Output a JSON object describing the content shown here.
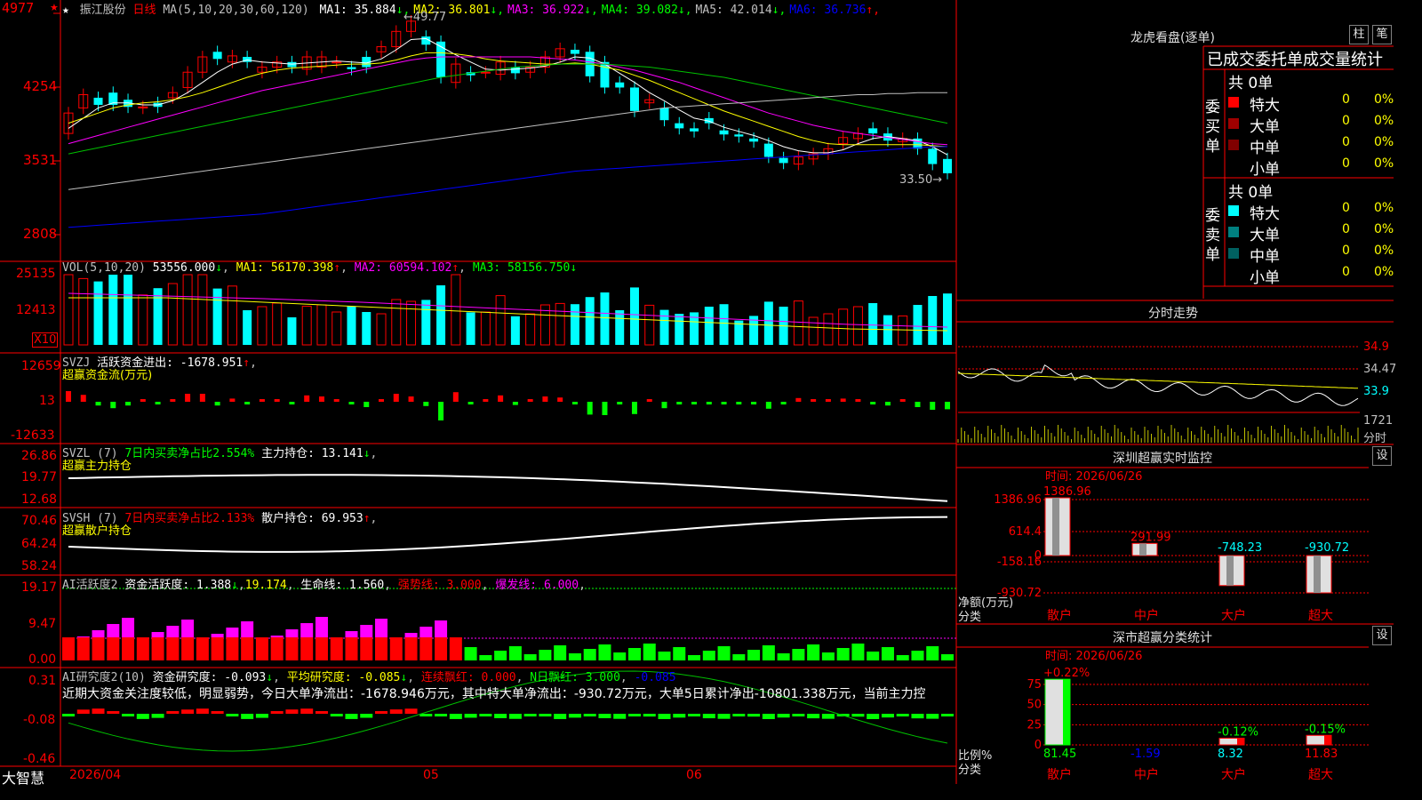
{
  "app": {
    "brand": "大智慧",
    "menu_star": "★",
    "menu_star_small": "★"
  },
  "header": {
    "stock_name": "振江股份",
    "period": "日线",
    "ma_text": "MA(5,10,20,30,60,120)",
    "ma_values": [
      {
        "label": "MA1: 35.884",
        "arrow": "↓",
        "color": "#ffffff"
      },
      {
        "label": "MA2: 36.801",
        "arrow": "↓",
        "color": "#ffff00"
      },
      {
        "label": "MA3: 36.922",
        "arrow": "↓",
        "color": "#ff00ff"
      },
      {
        "label": "MA4: 39.082",
        "arrow": "↓",
        "color": "#00ff00"
      },
      {
        "label": "MA5: 42.014",
        "arrow": "↓",
        "color": "#c0c0c0"
      },
      {
        "label": "MA6: 36.736",
        "arrow": "↑",
        "color": "#0000ff"
      }
    ]
  },
  "colors": {
    "up": "#ff0000",
    "down": "#00ffff",
    "grid": "#ff0000",
    "ma1": "#ffffff",
    "ma2": "#ffff00",
    "ma3": "#ff00ff",
    "ma4": "#00c000",
    "ma5": "#c0c0c0",
    "ma6": "#0000ff"
  },
  "price_panel": {
    "y_ticks": [
      "4977",
      "4254",
      "3531",
      "2808"
    ],
    "high_label": "49.77",
    "low_label": "33.50"
  },
  "vol_panel": {
    "title": "VOL(5,10,20)",
    "value": "53556.000",
    "ma1": "MA1: 56170.398",
    "ma1_arrow": "↑",
    "ma2": "MA2: 60594.102",
    "ma2_arrow": "↑",
    "ma3": "MA3: 58156.750",
    "ma3_arrow": "↓",
    "y_ticks": [
      "25135",
      "12413"
    ],
    "unit": "X10"
  },
  "svzj_panel": {
    "title": "SVZJ",
    "desc": "活跃资金进出: -1678.951",
    "arrow": "↑",
    "subtitle": "超赢资金流(万元)",
    "y_ticks": [
      "12659",
      "13",
      "-12633"
    ]
  },
  "svzl_panel": {
    "title": "SVZL (7)",
    "desc": "7日内买卖净占比2.554%",
    "desc2": "主力持仓: 13.141",
    "arrow": "↓",
    "subtitle": "超赢主力持仓",
    "y_ticks": [
      "26.86",
      "19.77",
      "12.68"
    ]
  },
  "svsh_panel": {
    "title": "SVSH (7)",
    "desc": "7日内买卖净占比2.133%",
    "desc2": "散户持仓: 69.953",
    "arrow": "↑",
    "subtitle": "超赢散户持仓",
    "y_ticks": [
      "70.46",
      "64.24",
      "58.24"
    ]
  },
  "ai_act_panel": {
    "title": "AI活跃度2",
    "desc": "资金活跃度: 1.388",
    "arrow": "↓",
    "val2": "19.174",
    "life": "生命线: 1.560",
    "strong": "强势线: 3.000",
    "burst": "爆发线: 6.000",
    "y_ticks": [
      "19.17",
      "9.47",
      "0.00"
    ]
  },
  "ai_res_panel": {
    "title": "AI研究度2(10)",
    "desc": "资金研究度: -0.093",
    "arrow1": "↓",
    "avg": "平均研究度: -0.085",
    "arrow2": "↓",
    "streak": "连续飘红: 0.000",
    "nday": "N日飘红: 3.000",
    "last": "-0.085",
    "comment": "近期大资金关注度较低，明显弱势，今日大单净流出：-1678.946万元，其中特大单净流出：-930.72万元，大单5日累计净出-10801.338万元，当前主力控",
    "y_ticks": [
      "0.31",
      "-0.08",
      "-0.46"
    ]
  },
  "x_axis": {
    "labels": [
      "2026/04",
      "05",
      "06"
    ]
  },
  "right": {
    "lhb_title": "龙虎看盘(逐单)",
    "btn_zhu": "柱",
    "btn_bi": "笔",
    "lhb_header": "已成交委托单成交量统计",
    "buy_label": "委买单",
    "sell_label": "委卖单",
    "buy_total": "共 0单",
    "sell_total": "共 0单",
    "buy_rows": [
      {
        "name": "特大",
        "count": "0",
        "pct": "0%",
        "color": "#ff0000"
      },
      {
        "name": "大单",
        "count": "0",
        "pct": "0%",
        "color": "#a00000"
      },
      {
        "name": "中单",
        "count": "0",
        "pct": "0%",
        "color": "#800000"
      },
      {
        "name": "小单",
        "count": "0",
        "pct": "0%",
        "color": "#000000"
      }
    ],
    "sell_rows": [
      {
        "name": "特大",
        "count": "0",
        "pct": "0%",
        "color": "#00ffff"
      },
      {
        "name": "大单",
        "count": "0",
        "pct": "0%",
        "color": "#008080"
      },
      {
        "name": "中单",
        "count": "0",
        "pct": "0%",
        "color": "#006060"
      },
      {
        "name": "小单",
        "count": "0",
        "pct": "0%",
        "color": "#000000"
      }
    ],
    "intraday_title": "分时走势",
    "intraday_ticks": [
      "34.9",
      "34.47",
      "33.9",
      "1721",
      "分时"
    ],
    "sz_monitor_title": "深圳超赢实时监控",
    "sz_monitor_time": "时间: 2026/06/26",
    "sz_monitor_btn": "设",
    "sz_monitor_yticks": [
      "1386.96",
      "614.4",
      "0",
      "-158.16",
      "-930.72"
    ],
    "sz_monitor_ylabel": "净额(万元)",
    "sz_monitor_xlabel": "分类",
    "sz_class_title": "深市超赢分类统计",
    "sz_class_time": "时间: 2026/06/26",
    "sz_class_btn": "设",
    "sz_class_yticks": [
      "75",
      "50",
      "25",
      "0"
    ],
    "sz_class_ylabel": "比例%",
    "sz_class_xlabel": "分类",
    "categories": [
      "散户",
      "中户",
      "大户",
      "超大"
    ]
  },
  "chart_data": [
    {
      "type": "bar",
      "title": "深圳超赢实时监控",
      "categories": [
        "散户",
        "中户",
        "大户",
        "超大"
      ],
      "values": [
        1386.96,
        291.99,
        -748.23,
        -930.72
      ],
      "value_labels": [
        "1386.96",
        "291.99",
        "-748.23",
        "-930.72"
      ],
      "ylabel": "净额(万元)",
      "xlabel": "分类",
      "ylim": [
        -930.72,
        1386.96
      ]
    },
    {
      "type": "bar",
      "title": "深市超赢分类统计",
      "categories": [
        "散户",
        "中户",
        "大户",
        "超大"
      ],
      "values": [
        81.45,
        -1.59,
        8.32,
        11.83
      ],
      "value_labels": [
        "81.45",
        "-1.59",
        "8.32",
        "11.83"
      ],
      "change_labels": [
        "+0.22%",
        "",
        "-0.12%",
        "-0.15%"
      ],
      "ylabel": "比例%",
      "xlabel": "分类",
      "ylim": [
        0,
        75
      ]
    },
    {
      "type": "line",
      "title": "振江股份 日线",
      "xlabel": "",
      "ylabel": "",
      "x_labels": [
        "2026/04",
        "05",
        "06"
      ],
      "ylim": [
        28.08,
        49.77
      ],
      "candles": {
        "open": [
          38.0,
          40.5,
          41.5,
          42.0,
          41.3,
          40.5,
          41.0,
          41.5,
          42.5,
          44.0,
          46.0,
          45.0,
          45.5,
          44.0,
          44.5,
          45.0,
          44.3,
          44.5,
          45.0,
          44.5,
          45.5,
          46.0,
          46.5,
          48.0,
          47.5,
          47.0,
          43.0,
          44.0,
          44.0,
          43.8,
          44.5,
          44.0,
          44.5,
          45.5,
          46.2,
          46.0,
          45.0,
          43.0,
          42.5,
          41.0,
          40.5,
          39.0,
          38.5,
          39.5,
          38.3,
          37.9,
          37.5,
          37.0,
          35.6,
          35.0,
          35.5,
          36.0,
          37.0,
          37.5,
          38.5,
          38.0,
          37.2,
          37.5,
          36.5,
          35.5
        ],
        "close": [
          40.0,
          41.8,
          40.8,
          40.8,
          40.6,
          40.6,
          40.6,
          42.0,
          44.0,
          45.5,
          45.3,
          45.6,
          45.0,
          44.5,
          45.0,
          44.5,
          45.5,
          45.5,
          45.0,
          44.3,
          44.5,
          46.5,
          48.0,
          49.0,
          46.7,
          43.5,
          44.8,
          43.7,
          44.0,
          45.0,
          43.9,
          44.5,
          45.5,
          46.3,
          45.8,
          43.6,
          42.5,
          42.5,
          40.2,
          41.3,
          39.3,
          38.5,
          38.2,
          39.0,
          37.9,
          37.7,
          37.2,
          35.7,
          35.1,
          35.7,
          36.0,
          36.5,
          37.6,
          38.0,
          38.0,
          37.3,
          37.5,
          36.5,
          35.0,
          34.1
        ]
      },
      "series": [
        {
          "name": "MA1",
          "values": [
            38.5,
            39.5,
            40.5,
            41.0,
            41.0,
            40.8,
            40.8,
            41.2,
            42.0,
            43.0,
            44.0,
            44.8,
            45.2,
            45.0,
            44.9,
            44.8,
            44.9,
            45.0,
            45.1,
            45.0,
            44.9,
            45.3,
            46.2,
            47.2,
            47.3,
            46.5,
            45.7,
            45.0,
            44.3,
            44.2,
            44.3,
            44.4,
            44.6,
            45.0,
            45.5,
            45.4,
            44.8,
            43.9,
            43.0,
            42.0,
            41.2,
            40.3,
            39.5,
            39.2,
            38.6,
            38.2,
            37.8,
            37.3,
            36.7,
            36.3,
            36.1,
            36.1,
            36.4,
            37.0,
            37.5,
            37.7,
            37.5,
            37.3,
            36.7,
            35.9
          ]
        },
        {
          "name": "MA2",
          "values": [
            39.0,
            39.5,
            40.0,
            40.5,
            40.8,
            41.0,
            41.1,
            41.3,
            41.6,
            42.0,
            42.5,
            43.0,
            43.5,
            43.9,
            44.2,
            44.4,
            44.5,
            44.6,
            44.7,
            44.8,
            44.8,
            44.9,
            45.2,
            45.6,
            45.9,
            45.9,
            45.8,
            45.6,
            45.3,
            45.1,
            45.0,
            44.9,
            44.8,
            44.8,
            44.9,
            44.8,
            44.5,
            44.2,
            43.7,
            43.2,
            42.6,
            42.0,
            41.4,
            40.8,
            40.2,
            39.7,
            39.2,
            38.7,
            38.2,
            37.7,
            37.3,
            37.0,
            36.9,
            36.9,
            36.9,
            36.9,
            36.9,
            36.9,
            36.8,
            36.7
          ]
        },
        {
          "name": "MA3",
          "values": [
            37.0,
            37.4,
            37.8,
            38.2,
            38.6,
            39.0,
            39.4,
            39.8,
            40.2,
            40.6,
            41.0,
            41.4,
            41.8,
            42.2,
            42.5,
            42.8,
            43.1,
            43.4,
            43.7,
            44.0,
            44.3,
            44.6,
            44.9,
            45.2,
            45.4,
            45.5,
            45.5,
            45.5,
            45.5,
            45.5,
            45.5,
            45.5,
            45.4,
            45.3,
            45.2,
            45.0,
            44.8,
            44.5,
            44.2,
            43.8,
            43.4,
            43.0,
            42.5,
            42.0,
            41.5,
            41.0,
            40.5,
            40.0,
            39.6,
            39.2,
            38.8,
            38.5,
            38.2,
            38.0,
            37.8,
            37.6,
            37.4,
            37.2,
            37.0,
            36.9
          ]
        },
        {
          "name": "MA4",
          "values": [
            36.0,
            36.3,
            36.6,
            36.9,
            37.2,
            37.5,
            37.8,
            38.1,
            38.4,
            38.7,
            39.0,
            39.3,
            39.6,
            39.9,
            40.2,
            40.5,
            40.8,
            41.1,
            41.4,
            41.7,
            42.0,
            42.3,
            42.6,
            42.9,
            43.2,
            43.5,
            43.7,
            43.9,
            44.1,
            44.3,
            44.5,
            44.6,
            44.7,
            44.8,
            44.8,
            44.8,
            44.8,
            44.7,
            44.6,
            44.5,
            44.3,
            44.1,
            43.9,
            43.7,
            43.5,
            43.2,
            42.9,
            42.6,
            42.3,
            42.0,
            41.7,
            41.4,
            41.1,
            40.8,
            40.5,
            40.2,
            39.9,
            39.6,
            39.3,
            39.0
          ]
        },
        {
          "name": "MA5",
          "values": [
            32.5,
            32.7,
            32.9,
            33.1,
            33.3,
            33.5,
            33.7,
            33.9,
            34.1,
            34.3,
            34.5,
            34.7,
            34.9,
            35.1,
            35.3,
            35.5,
            35.7,
            35.9,
            36.1,
            36.3,
            36.5,
            36.7,
            36.9,
            37.1,
            37.3,
            37.5,
            37.7,
            37.9,
            38.1,
            38.3,
            38.5,
            38.7,
            38.9,
            39.1,
            39.3,
            39.5,
            39.7,
            39.9,
            40.1,
            40.3,
            40.5,
            40.6,
            40.7,
            40.8,
            40.9,
            41.0,
            41.1,
            41.2,
            41.3,
            41.4,
            41.5,
            41.6,
            41.7,
            41.8,
            41.8,
            41.9,
            41.9,
            42.0,
            42.0,
            42.0
          ]
        },
        {
          "name": "MA6",
          "values": [
            28.8,
            28.9,
            29.0,
            29.1,
            29.2,
            29.3,
            29.4,
            29.5,
            29.6,
            29.7,
            29.8,
            29.9,
            30.0,
            30.1,
            30.3,
            30.5,
            30.7,
            30.9,
            31.1,
            31.3,
            31.5,
            31.7,
            31.9,
            32.1,
            32.3,
            32.5,
            32.7,
            32.9,
            33.1,
            33.3,
            33.5,
            33.7,
            33.9,
            34.1,
            34.3,
            34.4,
            34.5,
            34.6,
            34.7,
            34.8,
            34.9,
            35.0,
            35.1,
            35.2,
            35.3,
            35.4,
            35.5,
            35.6,
            35.7,
            35.8,
            35.9,
            36.0,
            36.1,
            36.2,
            36.3,
            36.4,
            36.5,
            36.6,
            36.7,
            36.7
          ]
        }
      ]
    }
  ]
}
